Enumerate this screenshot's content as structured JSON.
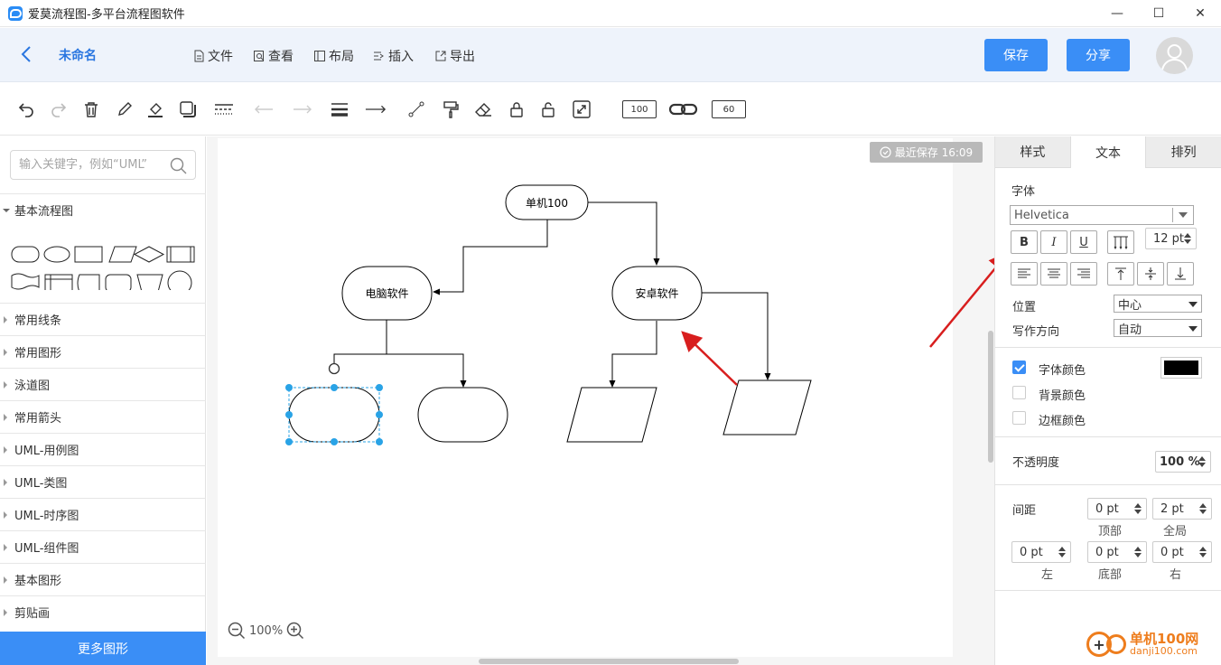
{
  "window": {
    "title": "爱莫流程图-多平台流程图软件",
    "minimize": "—",
    "maximize": "☐",
    "close": "✕"
  },
  "header": {
    "doc_name": "未命名",
    "menu": [
      {
        "label": "文件",
        "icon": "file-icon"
      },
      {
        "label": "查看",
        "icon": "view-icon"
      },
      {
        "label": "布局",
        "icon": "layout-icon"
      },
      {
        "label": "插入",
        "icon": "insert-icon"
      },
      {
        "label": "导出",
        "icon": "export-icon"
      }
    ],
    "save_label": "保存",
    "share_label": "分享",
    "accent": "#3a8ef6"
  },
  "toolbar": {
    "icons": [
      "undo-icon",
      "redo-icon",
      "delete-icon",
      "edit-icon",
      "fill-icon",
      "shadow-icon",
      "dashed-line-icon",
      "arrow-left-icon",
      "arrow-right-icon",
      "line-weight-icon",
      "connector-arrow-icon",
      "waypoint-icon",
      "format-painter-icon",
      "eraser-icon",
      "lock-icon",
      "unlock-icon",
      "fit-icon",
      "link-icon"
    ],
    "box_left": "100",
    "box_right": "60"
  },
  "sidebar": {
    "search_placeholder": "输入关键字，例如“UML”",
    "open_category": "基本流程图",
    "categories": [
      "常用线条",
      "常用图形",
      "泳道图",
      "常用箭头",
      "UML-用例图",
      "UML-类图",
      "UML-时序图",
      "UML-组件图",
      "基本图形",
      "剪贴画"
    ],
    "more_label": "更多图形",
    "splitter": "‖"
  },
  "canvas": {
    "save_status": "最近保存 16:09",
    "zoom": "100%",
    "nodes": {
      "root": "单机100",
      "left": "电脑软件",
      "right": "安卓软件"
    }
  },
  "right_panel": {
    "tabs": [
      "样式",
      "文本",
      "排列"
    ],
    "active_tab": "文本",
    "font_section": "字体",
    "font_family": "Helvetica",
    "font_size": "12 pt",
    "bold": "B",
    "italic": "I",
    "underline": "U",
    "position_label": "位置",
    "position_value": "中心",
    "direction_label": "写作方向",
    "direction_value": "自动",
    "font_color_label": "字体颜色",
    "font_color_checked": true,
    "font_color": "#000000",
    "bg_color_label": "背景颜色",
    "border_color_label": "边框颜色",
    "opacity_label": "不透明度",
    "opacity_value": "100 %",
    "spacing_label": "间距",
    "spacing": {
      "top_value": "0 pt",
      "top_label": "顶部",
      "global_value": "2 pt",
      "global_label": "全局",
      "left_value": "0 pt",
      "left_label": "左",
      "bottom_value": "0 pt",
      "bottom_label": "底部",
      "right_value": "0 pt",
      "right_label": "右"
    }
  },
  "watermark": {
    "site_name": "单机100网",
    "site_url": "danji100.com",
    "color": "#ee7d1d"
  }
}
